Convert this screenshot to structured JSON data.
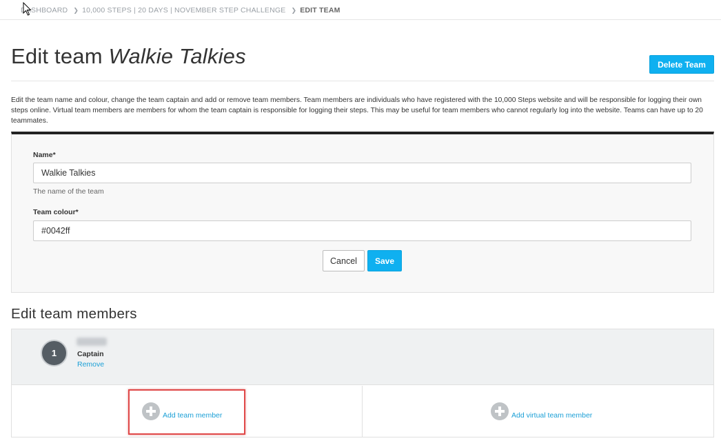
{
  "breadcrumb": {
    "items": [
      "DASHBOARD",
      "10,000 STEPS | 20 DAYS | NOVEMBER STEP CHALLENGE",
      "EDIT TEAM"
    ],
    "separator_icon": "chevron-right-icon"
  },
  "header": {
    "title_prefix": "Edit team",
    "team_name": "Walkie Talkies",
    "delete_label": "Delete Team"
  },
  "intro": {
    "text": "Edit the team name and colour, change the team captain and add or remove team members. Team members are individuals who have registered with the 10,000 Steps website and will be responsible for logging their own steps online. Virtual team members are members for whom the team captain is responsible for logging their steps. This may be useful for team members who cannot regularly log into the website. Teams can have up to 20 teammates."
  },
  "form": {
    "name_label": "Name*",
    "name_value": "Walkie Talkies",
    "name_help": "The name of the team",
    "colour_label": "Team colour*",
    "colour_value": "#0042ff",
    "cancel_label": "Cancel",
    "save_label": "Save"
  },
  "members": {
    "section_title": "Edit team members",
    "list": [
      {
        "number": "1",
        "role": "Captain",
        "remove_label": "Remove"
      }
    ],
    "add_member_label": "Add team member",
    "add_virtual_label": "Add virtual team member"
  },
  "colors": {
    "accent": "#0fb0f0",
    "link": "#1a9fd6",
    "highlight": "#e04848"
  }
}
